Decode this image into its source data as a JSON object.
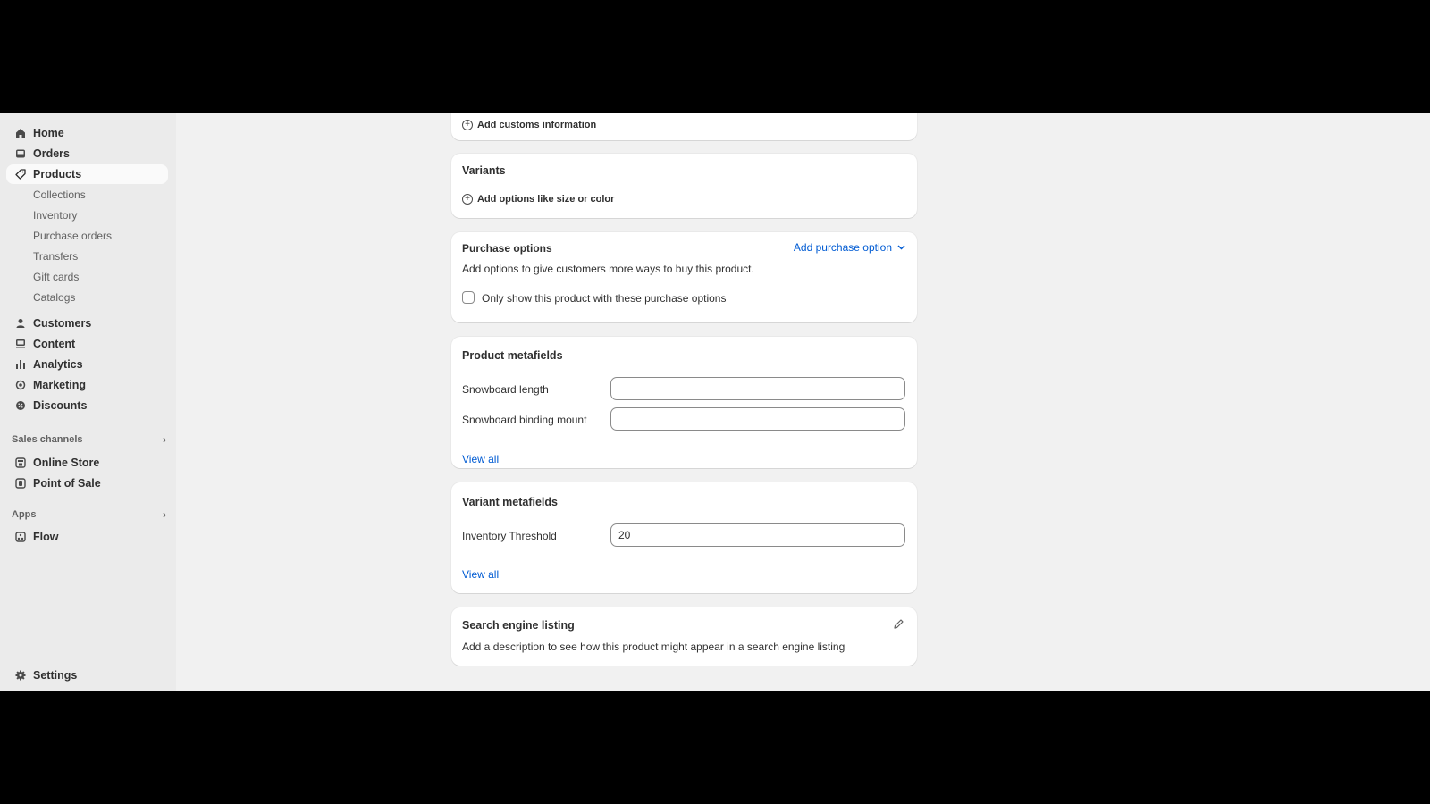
{
  "sidebar": {
    "main_items": [
      {
        "label": "Home",
        "icon": "home-icon"
      },
      {
        "label": "Orders",
        "icon": "inbox-icon"
      },
      {
        "label": "Products",
        "icon": "tag-icon",
        "active": true
      }
    ],
    "product_subitems": [
      "Collections",
      "Inventory",
      "Purchase orders",
      "Transfers",
      "Gift cards",
      "Catalogs"
    ],
    "secondary_items": [
      {
        "label": "Customers",
        "icon": "person-icon"
      },
      {
        "label": "Content",
        "icon": "content-icon"
      },
      {
        "label": "Analytics",
        "icon": "bar-chart-icon"
      },
      {
        "label": "Marketing",
        "icon": "target-icon"
      },
      {
        "label": "Discounts",
        "icon": "discount-icon"
      }
    ],
    "sales_channels": {
      "heading": "Sales channels",
      "items": [
        {
          "label": "Online Store",
          "icon": "store-icon"
        },
        {
          "label": "Point of Sale",
          "icon": "pos-icon"
        }
      ]
    },
    "apps": {
      "heading": "Apps",
      "items": [
        {
          "label": "Flow",
          "icon": "flow-icon"
        }
      ]
    },
    "settings": {
      "label": "Settings",
      "icon": "gear-icon"
    }
  },
  "main": {
    "customs": {
      "add_label": "Add customs information"
    },
    "variants": {
      "title": "Variants",
      "add_label": "Add options like size or color"
    },
    "purchase_options": {
      "title": "Purchase options",
      "action_label": "Add purchase option",
      "description": "Add options to give customers more ways to buy this product.",
      "checkbox_label": "Only show this product with these purchase options",
      "checkbox_checked": false
    },
    "product_metafields": {
      "title": "Product metafields",
      "fields": [
        {
          "label": "Snowboard length",
          "value": ""
        },
        {
          "label": "Snowboard binding mount",
          "value": ""
        }
      ],
      "view_all": "View all"
    },
    "variant_metafields": {
      "title": "Variant metafields",
      "fields": [
        {
          "label": "Inventory Threshold",
          "value": "20"
        }
      ],
      "view_all": "View all"
    },
    "seo": {
      "title": "Search engine listing",
      "description": "Add a description to see how this product might appear in a search engine listing"
    }
  },
  "colors": {
    "link": "#005bd3",
    "sidebar_bg": "#ebebeb",
    "page_bg": "#f1f1f1"
  }
}
